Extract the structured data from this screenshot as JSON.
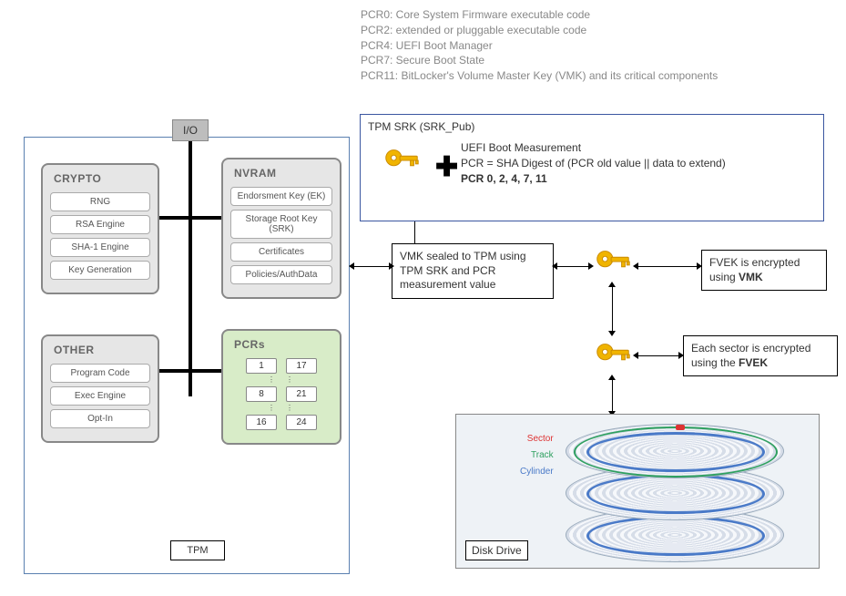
{
  "pcr_descriptions": {
    "pcr0": "PCR0: Core System Firmware executable code",
    "pcr2": "PCR2: extended or pluggable executable code",
    "pcr4": "PCR4: UEFI Boot Manager",
    "pcr7": "PCR7: Secure Boot State",
    "pcr11": "PCR11: BitLocker's Volume Master Key (VMK) and its critical components"
  },
  "tpm": {
    "label": "TPM",
    "io": "I/O",
    "crypto": {
      "title": "CRYPTO",
      "items": [
        "RNG",
        "RSA Engine",
        "SHA-1 Engine",
        "Key Generation"
      ]
    },
    "nvram": {
      "title": "NVRAM",
      "items": [
        "Endorsment Key (EK)",
        "Storage Root Key (SRK)",
        "Certificates",
        "Policies/AuthData"
      ]
    },
    "other": {
      "title": "OTHER",
      "items": [
        "Program Code",
        "Exec Engine",
        "Opt-In"
      ]
    },
    "pcrs": {
      "title": "PCRs",
      "left": [
        "1",
        "8",
        "16"
      ],
      "right": [
        "17",
        "21",
        "24"
      ]
    }
  },
  "srk": {
    "title": "TPM SRK (SRK_Pub)",
    "uefi_title": "UEFI Boot Measurement",
    "formula": "PCR = SHA Digest of (PCR old value || data to extend)",
    "pcr_list": "PCR 0, 2, 4, 7, 11"
  },
  "boxes": {
    "vmk_seal": "VMK sealed to TPM using TPM SRK and PCR measurement value",
    "fvek_enc_pre": "FVEK is encrypted using ",
    "fvek_enc_bold": "VMK",
    "sector_enc_pre": "Each sector is encrypted using the ",
    "sector_enc_bold": "FVEK"
  },
  "disk": {
    "label": "Disk Drive",
    "legend": {
      "sector": "Sector",
      "track": "Track",
      "cylinder": "Cylinder"
    }
  }
}
